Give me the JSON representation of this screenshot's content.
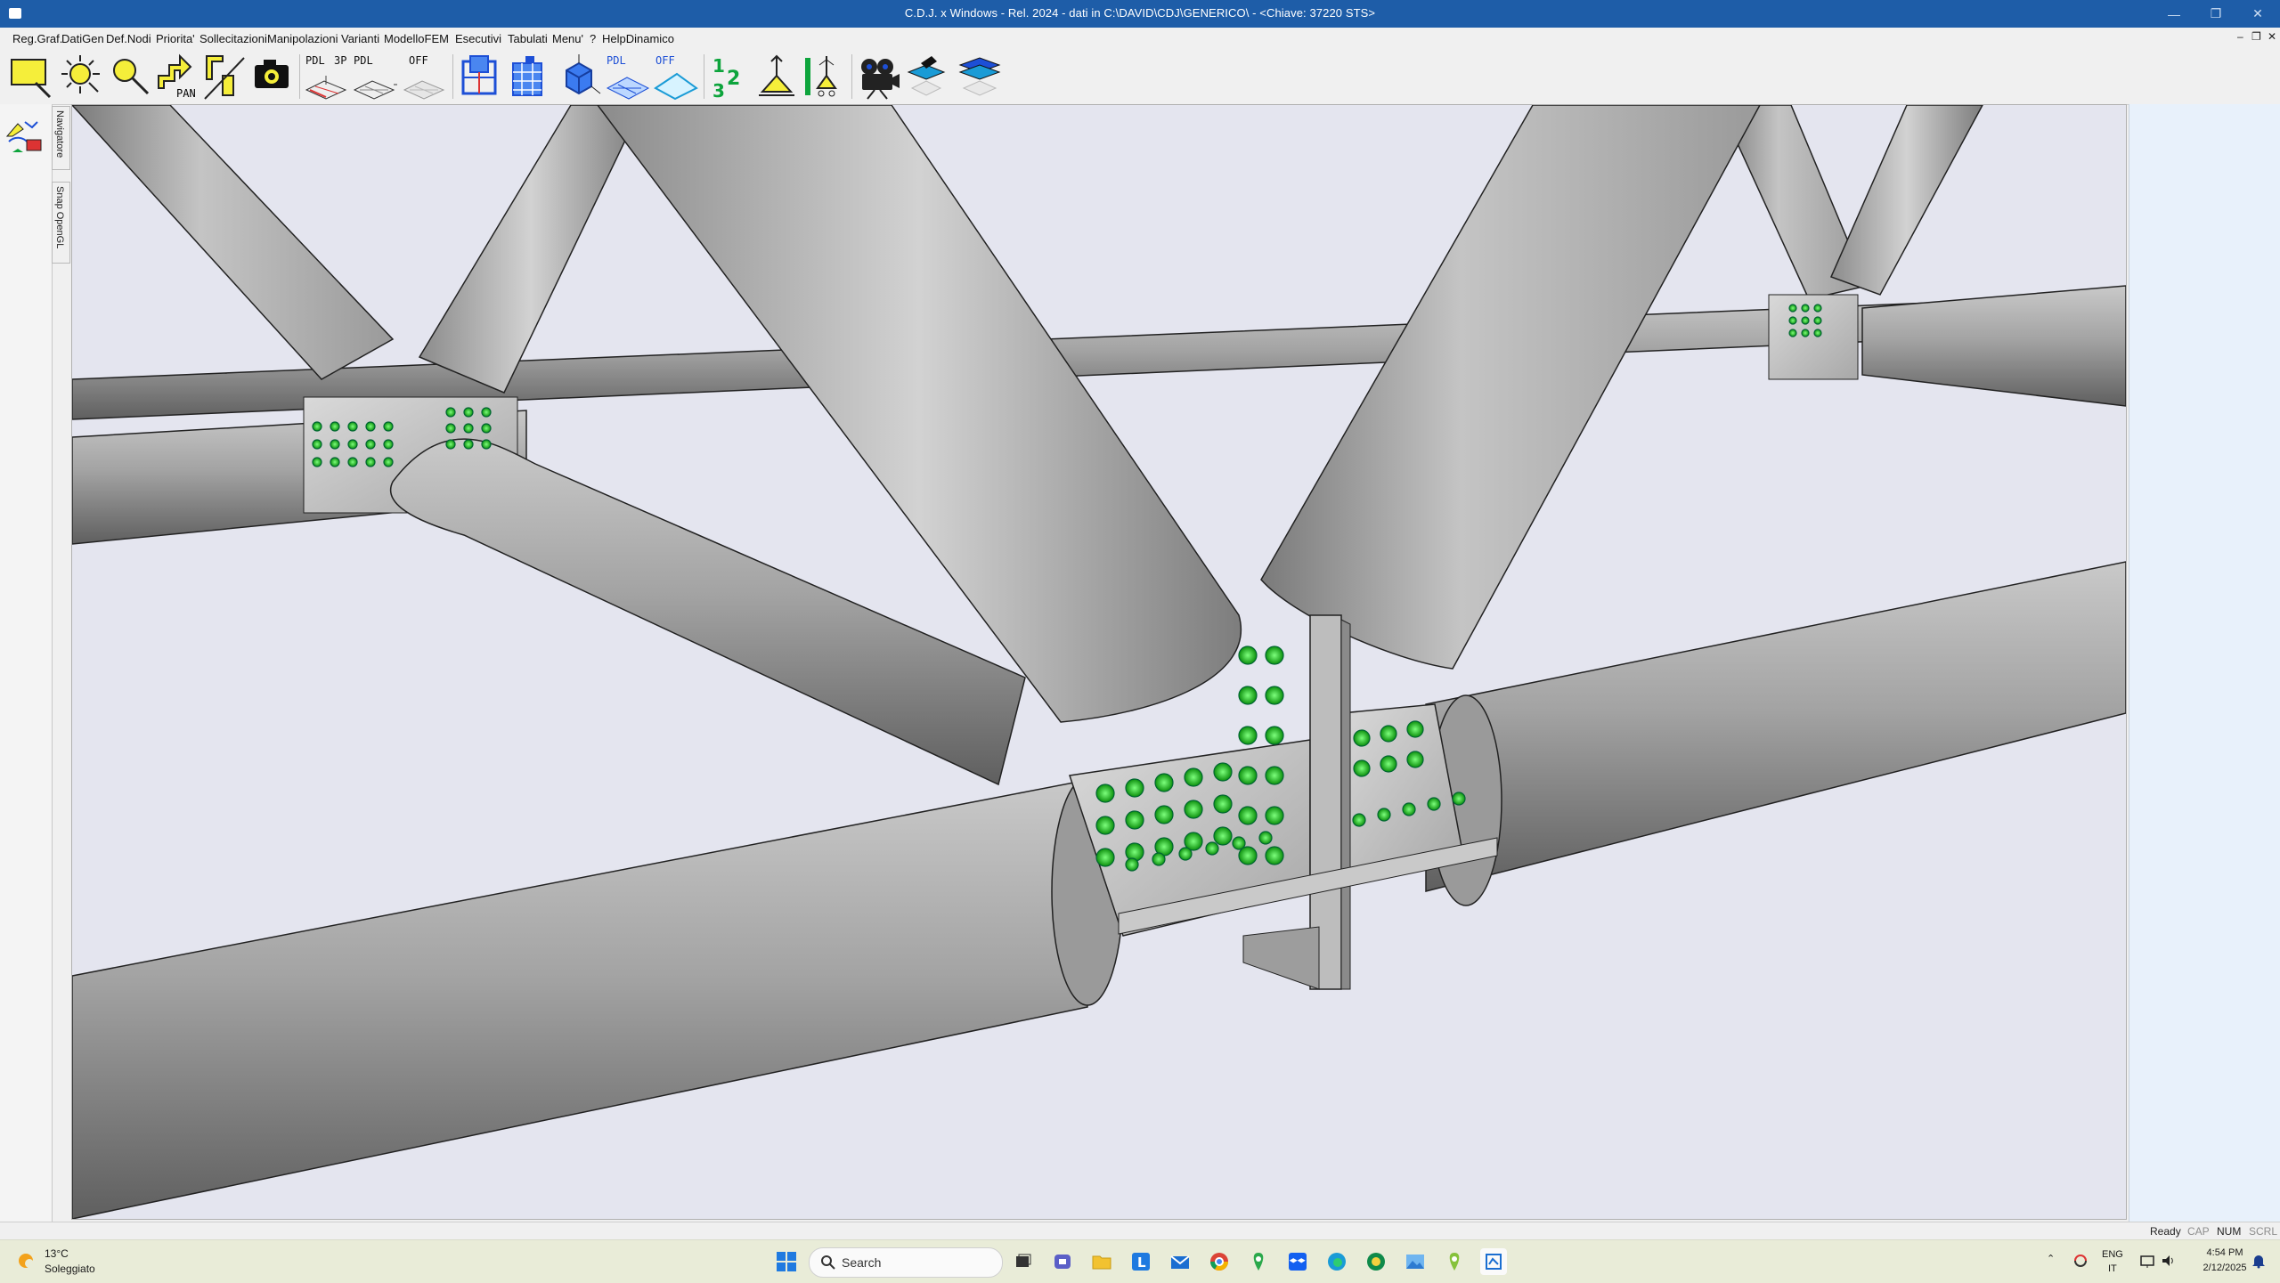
{
  "window": {
    "title": "C.D.J. x Windows - Rel. 2024 - dati in C:\\DAVID\\CDJ\\GENERICO\\ - <Chiave: 37220 STS>",
    "controls": {
      "minimize": "—",
      "restore": "❐",
      "close": "✕"
    }
  },
  "menu": {
    "items": [
      "Reg.Graf.",
      "DatiGen",
      "Def.Nodi",
      "Priorita'",
      "Sollecitazioni",
      "Manipolazioni",
      "Varianti",
      "ModelloFEM",
      "Esecutivi",
      "Tabulati",
      "Menu'",
      "?",
      "HelpDinamico"
    ],
    "mdi_controls": {
      "minimize": "–",
      "restore": "❐",
      "close": "✕"
    }
  },
  "toolbar": {
    "labels": {
      "pdl1": "PDL",
      "p3": "3P",
      "pdl2": "PDL",
      "off1": "OFF",
      "pdl3": "PDL",
      "off2": "OFF",
      "pan": "PAN"
    },
    "icons": [
      "zoom-window-icon",
      "zoom-all-icon",
      "zoom-icon",
      "pan-icon",
      "section-icon",
      "camera-icon",
      "plane-pdl-icon",
      "plane-3p-icon",
      "plane-off-icon",
      "frame-view-icon",
      "building-view-icon",
      "cube-view-icon",
      "plane-pdl2-icon",
      "plane-off2-icon",
      "numbering-icon",
      "support-icon",
      "constraint-icon",
      "film-camera-icon",
      "layer-icon",
      "layers-icon"
    ]
  },
  "side_tabs": {
    "navigator": "Navigatore",
    "snap": "Snap OpenGL"
  },
  "status": {
    "ready": "Ready",
    "cap": "CAP",
    "num": "NUM",
    "scrl": "SCRL"
  },
  "taskbar": {
    "weather": {
      "temp": "13°C",
      "condition": "Soleggiato"
    },
    "search_placeholder": "Search",
    "lang": {
      "line1": "ENG",
      "line2": "IT"
    },
    "clock": {
      "time": "4:54 PM",
      "date": "2/12/2025"
    },
    "apps": [
      "start-icon",
      "search-icon",
      "task-view-icon",
      "teams-icon",
      "file-explorer-icon",
      "l-app-icon",
      "mail-icon",
      "chrome-icon",
      "maps-icon",
      "dropbox-icon",
      "edge-icon",
      "green-app-icon",
      "photos-icon",
      "maps2-icon",
      "cdj-app-icon"
    ]
  },
  "colors": {
    "titlebar": "#1e5da8",
    "viewport_bg": "#e4e5ef",
    "bolt": "#1fd11f",
    "steel": "#a9a9a9",
    "taskbar": "#e9ecd8"
  }
}
